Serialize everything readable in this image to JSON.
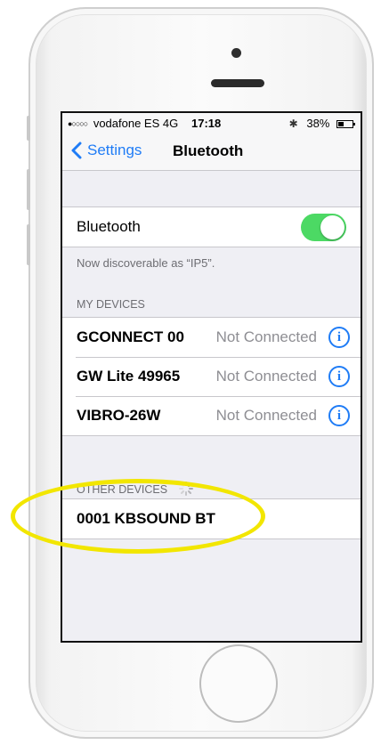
{
  "status_bar": {
    "carrier": "vodafone ES",
    "network": "4G",
    "time": "17:18",
    "battery": "38%",
    "battery_level": 0.38
  },
  "nav": {
    "back_label": "Settings",
    "title": "Bluetooth"
  },
  "bluetooth": {
    "label": "Bluetooth",
    "enabled": true,
    "toggle_color": "#4cd964",
    "discoverable_text": "Now discoverable as “IP5”."
  },
  "my_devices": {
    "header": "MY DEVICES",
    "items": [
      {
        "name": "GCONNECT 00",
        "status": "Not Connected"
      },
      {
        "name": "GW Lite 49965",
        "status": "Not Connected"
      },
      {
        "name": "VIBRO-26W",
        "status": "Not Connected"
      }
    ]
  },
  "other_devices": {
    "header": "OTHER DEVICES",
    "items": [
      {
        "name": "0001 KBSOUND BT"
      }
    ]
  },
  "colors": {
    "accent": "#1f7cf6",
    "highlight": "#f2e600"
  }
}
